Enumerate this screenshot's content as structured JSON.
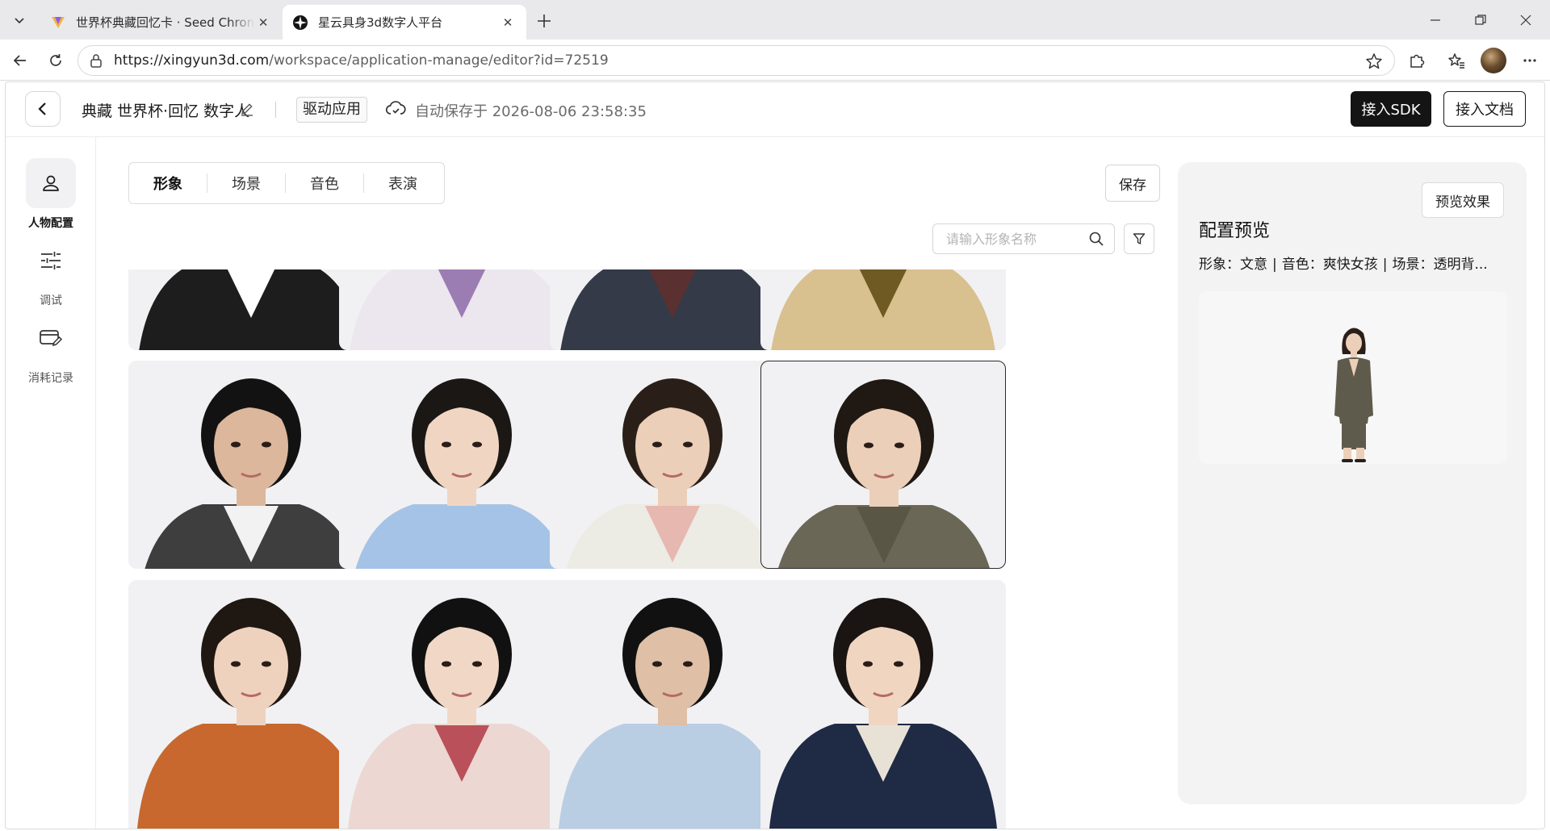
{
  "browser": {
    "tabs": [
      {
        "title": "世界杯典藏回忆卡 · Seed Chronicle",
        "active": false
      },
      {
        "title": "星云具身3d数字人平台",
        "active": true
      }
    ],
    "url_host": "https://xingyun3d.com",
    "url_path": "/workspace/application-manage/editor?id=72519"
  },
  "header": {
    "title": "典藏 世界杯·回忆 数字人",
    "mode_badge": "驱动应用",
    "autosave": "自动保存于 2026-08-06 23:58:35",
    "sdk_button": "接入SDK",
    "doc_button": "接入文档"
  },
  "sidebar": {
    "items": [
      {
        "label": "人物配置",
        "icon": "person-icon",
        "active": true
      },
      {
        "label": "调试",
        "icon": "sliders-icon",
        "active": false
      },
      {
        "label": "消耗记录",
        "icon": "card-edit-icon",
        "active": false
      }
    ]
  },
  "editor": {
    "tabs": [
      "形象",
      "场景",
      "音色",
      "表演"
    ],
    "active_tab": "形象",
    "save_label": "保存",
    "search_placeholder": "请输入形象名称"
  },
  "avatars": [
    {
      "skin": "#d9b8a0",
      "hair": "#151515",
      "outfit": "#1d1d1d",
      "accent": "#ffffff",
      "selected": false
    },
    {
      "skin": "#efd8c6",
      "hair": "#1a1412",
      "outfit": "#ece6ee",
      "accent": "#9b7db3",
      "selected": false
    },
    {
      "skin": "#e1c1a8",
      "hair": "#171717",
      "outfit": "#343a48",
      "accent": "#5a3030",
      "selected": false
    },
    {
      "skin": "#e9cdb4",
      "hair": "#1a1410",
      "outfit": "#d9c08f",
      "accent": "#6e5a22",
      "selected": false
    },
    {
      "skin": "#dcb79c",
      "hair": "#121212",
      "outfit": "#3e3e3e",
      "accent": "#f2f2f2",
      "selected": false
    },
    {
      "skin": "#f0d6c2",
      "hair": "#1b1715",
      "outfit": "#a5c3e6",
      "accent": "#a5c3e6",
      "selected": false
    },
    {
      "skin": "#eccfb8",
      "hair": "#2a1f18",
      "outfit": "#ecebe4",
      "accent": "#e6b8b0",
      "selected": false
    },
    {
      "skin": "#ebcfb8",
      "hair": "#1f1813",
      "outfit": "#6b6756",
      "accent": "#5a5646",
      "selected": true
    },
    {
      "skin": "#efd2bd",
      "hair": "#1f1712",
      "outfit": "#c8682e",
      "accent": "#c8682e",
      "selected": false
    },
    {
      "skin": "#f1d8c6",
      "hair": "#111111",
      "outfit": "#ecd7d2",
      "accent": "#b9505a",
      "selected": false
    },
    {
      "skin": "#dfbfa6",
      "hair": "#111111",
      "outfit": "#b9cde3",
      "accent": "#b9cde3",
      "selected": false
    },
    {
      "skin": "#f0d5c1",
      "hair": "#1a1412",
      "outfit": "#1f2a45",
      "accent": "#e8e2d6",
      "selected": false
    }
  ],
  "preview": {
    "button": "预览效果",
    "title": "配置预览",
    "summary": [
      "形象：文意",
      "音色：爽快女孩",
      "场景：透明背..."
    ]
  },
  "colors": {
    "primary_dark": "#141414",
    "card_bg": "#f1f1f3",
    "panel_bg": "#f3f3f4"
  }
}
